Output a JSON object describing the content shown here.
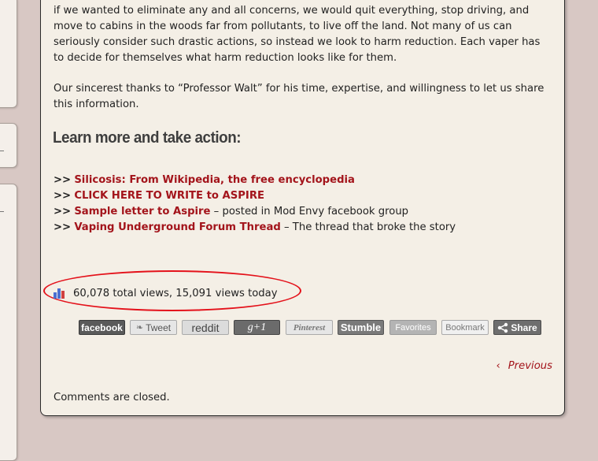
{
  "article": {
    "para1_lines": [
      "if we wanted to eliminate any and all concerns, we would quit everything, stop driving, and",
      "move to cabins in the woods far from pollutants, to live off the land. Not many of us can",
      "seriously consider such drastic actions, so instead we look to harm reduction. Each vaper has",
      "to decide for themselves what harm reduction looks like for them."
    ],
    "para2_lines": [
      "Our sincerest thanks to “Professor Walt” for his time, expertise, and willingness to let us share",
      "this information."
    ],
    "heading": "Learn more and take action:",
    "links": [
      {
        "prefix": ">>",
        "link": "Silicosis: From Wikipedia, the free encyclopedia",
        "suffix": ""
      },
      {
        "prefix": ">>",
        "link": "CLICK HERE TO WRITE to ASPIRE",
        "suffix": ""
      },
      {
        "prefix": ">>",
        "link": "Sample letter to Aspire",
        "suffix": " – posted in Mod Envy facebook group"
      },
      {
        "prefix": ">>",
        "link": "Vaping Underground Forum Thread",
        "suffix": " – The thread that broke the story"
      }
    ],
    "views_text": "60,078 total views, 15,091 views today"
  },
  "share": {
    "facebook": "facebook",
    "tweet": "Tweet",
    "reddit": "reddit",
    "gplus": "g+1",
    "pinterest": "Pinterest",
    "stumble": "Stumble",
    "favorites": "Favorites",
    "bookmark": "Bookmark",
    "share": "Share"
  },
  "nav": {
    "previous": "Previous",
    "previous_icon": "chevron-left-icon"
  },
  "comments_status": "Comments are closed.",
  "colors": {
    "link": "#a3141b",
    "highlight_ellipse": "#e4121b",
    "facebook_bg": "#5a5a5a",
    "page_bg": "#d8c8c4",
    "panel_bg": "#f4efe6"
  }
}
